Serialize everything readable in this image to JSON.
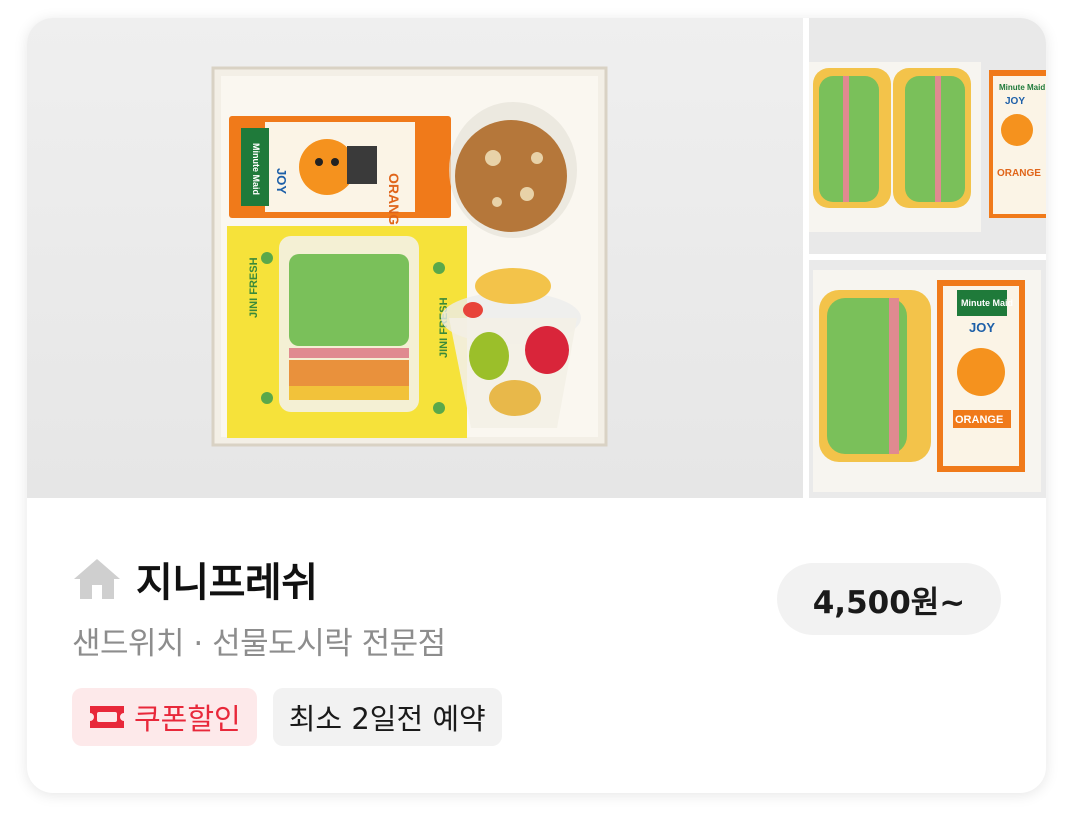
{
  "store": {
    "name": "지니프레쉬",
    "category": "샌드위치 · 선물도시락 전문점",
    "price": "4,500원~"
  },
  "tags": {
    "coupon": "쿠폰할인",
    "reservation": "최소 2일전 예약"
  },
  "images": {
    "juice_brand": "Minute Maid",
    "juice_name": "JOY",
    "juice_flavor": "ORANGE",
    "wrap_text": "JINI FRESH"
  },
  "colors": {
    "coupon_red": "#e8283a",
    "coupon_bg": "#fde9ea",
    "chip_bg": "#f2f2f2"
  }
}
